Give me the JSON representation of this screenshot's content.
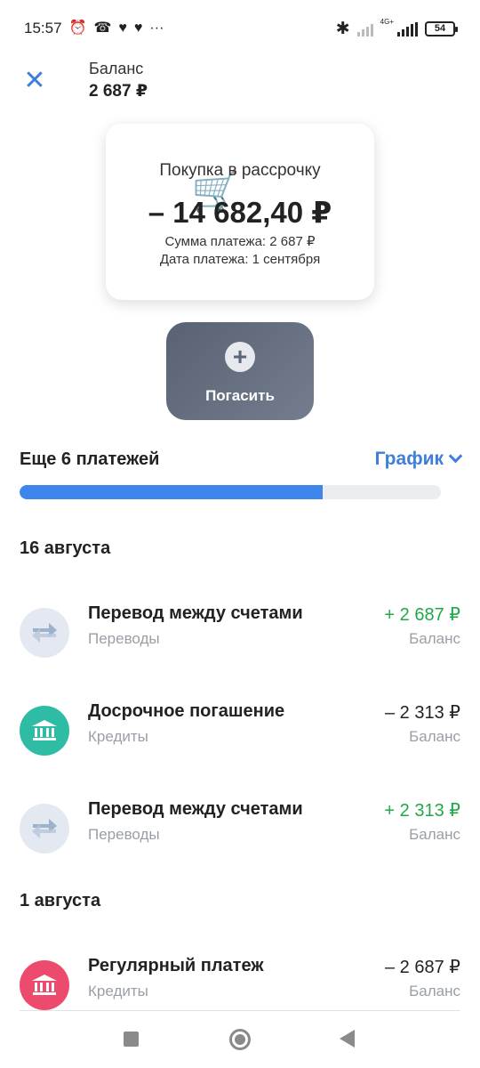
{
  "status_bar": {
    "time": "15:57",
    "icons": [
      "alarm-icon",
      "missed-call-icon",
      "health-icon",
      "heart-icon",
      "more-dots-icon"
    ],
    "network": "4G+",
    "battery": "54"
  },
  "header": {
    "title": "Баланс",
    "balance": "2 687 ₽"
  },
  "card": {
    "title": "Покупка в рассрочку",
    "amount": "– 14 682,40 ₽",
    "payment_sum": "Сумма платежа: 2 687 ₽",
    "payment_date": "Дата платежа: 1 сентября"
  },
  "pay_button": {
    "label": "Погасить"
  },
  "installments": {
    "remaining_label": "Еще 6 платежей",
    "schedule_label": "График",
    "progress": 0.72
  },
  "groups": [
    {
      "date": "16 августа",
      "transactions": [
        {
          "name": "Перевод между счетами",
          "category": "Переводы",
          "amount": "+ 2 687 ₽",
          "account": "Баланс",
          "icon": "transfer-icon"
        },
        {
          "name": "Досрочное погашение",
          "category": "Кредиты",
          "amount": "– 2 313 ₽",
          "account": "Баланс",
          "icon": "bank-icon"
        },
        {
          "name": "Перевод между счетами",
          "category": "Переводы",
          "amount": "+ 2 313 ₽",
          "account": "Баланс",
          "icon": "transfer-icon"
        }
      ]
    },
    {
      "date": "1 августа",
      "transactions": [
        {
          "name": "Регулярный платеж",
          "category": "Кредиты",
          "amount": "– 2 687 ₽",
          "account": "Баланс",
          "icon": "bank-icon"
        }
      ]
    }
  ],
  "colors": {
    "accent": "#3d7fdb",
    "progress": "#3e86ec",
    "positive": "#20a849",
    "bank_green": "#2fbca4",
    "bank_red": "#ec4b6e",
    "pay_button": "#646e7f"
  }
}
